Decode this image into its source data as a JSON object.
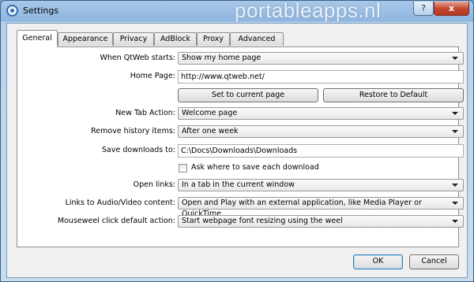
{
  "window": {
    "title": "Settings",
    "watermark": "portableapps.nl",
    "help_label": "?",
    "close_label": "x"
  },
  "tabs": [
    "General",
    "Appearance",
    "Privacy",
    "AdBlock",
    "Proxy",
    "Advanced"
  ],
  "active_tab": "General",
  "form": {
    "when_starts": {
      "label": "When QtWeb starts:",
      "value": "Show my home page"
    },
    "home_page": {
      "label": "Home Page:",
      "value": "http://www.qtweb.net/"
    },
    "set_current_label": "Set to current page",
    "restore_default_label": "Restore to Default",
    "new_tab": {
      "label": "New Tab Action:",
      "value": "Welcome page"
    },
    "remove_history": {
      "label": "Remove history items:",
      "value": "After one week"
    },
    "save_downloads": {
      "label": "Save downloads to:",
      "value": "C:\\Docs\\Downloads\\Downloads"
    },
    "ask_where": {
      "label": "Ask where to save each download",
      "checked": false
    },
    "open_links": {
      "label": "Open links:",
      "value": "In a tab in the current window"
    },
    "links_av": {
      "label": "Links to Audio/Video content:",
      "value": "Open and Play with an external application, like Media Player or QuickTime"
    },
    "mousewheel": {
      "label": "Mouseweel click default action:",
      "value": "Start webpage font resizing using the weel"
    }
  },
  "footer": {
    "ok_label": "OK",
    "cancel_label": "Cancel"
  }
}
